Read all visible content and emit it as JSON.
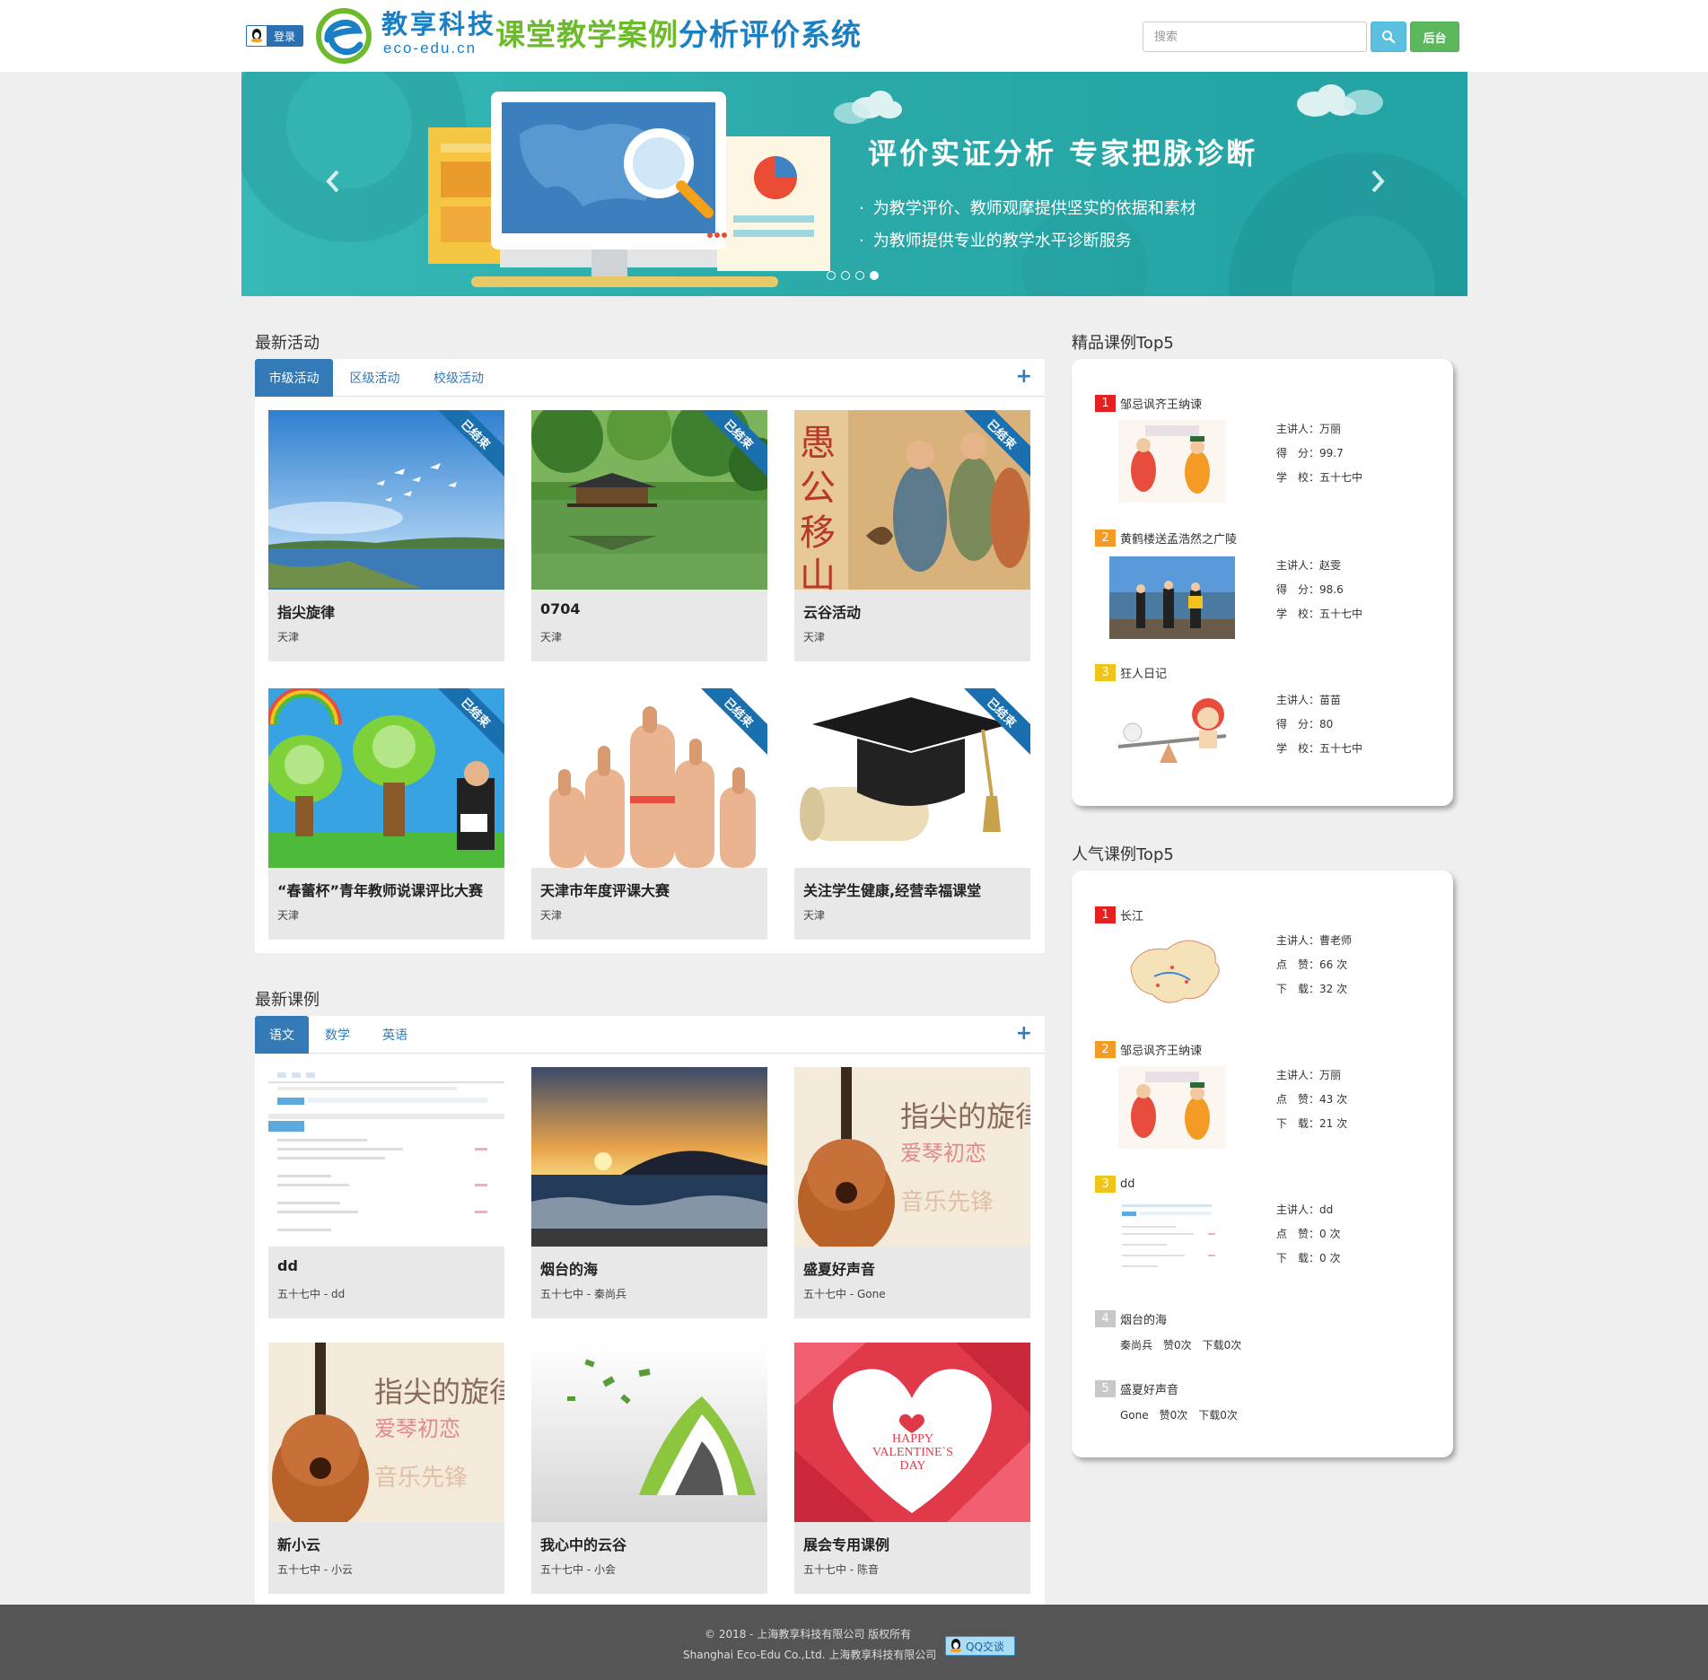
{
  "header": {
    "login_label": "登录",
    "logo_cn": "教享科技",
    "logo_en": "eco-edu.cn",
    "title_green": "课堂教学案例",
    "title_blue": "分析评价系统",
    "search_placeholder": "搜索",
    "admin_label": "后台"
  },
  "banner": {
    "headline": "评价实证分析 专家把脉诊断",
    "bullets": [
      "为教学评价、教师观摩提供坚实的依据和素材",
      "为教师提供专业的教学水平诊断服务"
    ],
    "slide_count": 4,
    "active_slide": 4
  },
  "activities": {
    "title": "最新活动",
    "tabs": [
      "市级活动",
      "区级活动",
      "校级活动"
    ],
    "active_tab": 0,
    "plus": "+",
    "ribbon_label": "已结束",
    "cards": [
      {
        "title": "指尖旋律",
        "sub": "天津",
        "thumb": "sky-lake"
      },
      {
        "title": "0704",
        "sub": "天津",
        "thumb": "pavilion"
      },
      {
        "title": "云谷活动",
        "sub": "天津",
        "thumb": "yugong-painting"
      },
      {
        "title": "“春蕾杯”青年教师说课评比大赛",
        "sub": "天津",
        "thumb": "trees-cartoon"
      },
      {
        "title": "天津市年度评课大赛",
        "sub": "天津",
        "thumb": "thumbs-up"
      },
      {
        "title": "关注学生健康,经营幸福课堂",
        "sub": "天津",
        "thumb": "grad-cap"
      }
    ]
  },
  "lessons": {
    "title": "最新课例",
    "tabs": [
      "语文",
      "数学",
      "英语"
    ],
    "active_tab": 0,
    "plus": "+",
    "cards": [
      {
        "title": "dd",
        "sub": "五十七中 - dd",
        "thumb": "screenshot"
      },
      {
        "title": "烟台的海",
        "sub": "五十七中 - 秦尚兵",
        "thumb": "sunset-sea"
      },
      {
        "title": "盛夏好声音",
        "sub": "五十七中 - Gone",
        "thumb": "guitar"
      },
      {
        "title": "新小云",
        "sub": "五十七中 - 小云",
        "thumb": "guitar"
      },
      {
        "title": "我心中的云谷",
        "sub": "五十七中 - 小会",
        "thumb": "book-art"
      },
      {
        "title": "展会专用课例",
        "sub": "五十七中 - 陈音",
        "thumb": "valentine"
      }
    ],
    "overlay_texts": {
      "guitar_title": "指尖的旋律",
      "guitar_sub1": "爱琴初恋",
      "guitar_sub2": "音乐先锋",
      "valentine": "HAPPY VALENTINE`S DAY"
    }
  },
  "top_quality": {
    "title": "精品课例Top5",
    "items": [
      {
        "rank": "1",
        "name": "邹忌讽齐王纳谏",
        "speaker": "主讲人：万丽",
        "score": "得　分：99.7",
        "school": "学　校：五十七中",
        "color": "#e52020"
      },
      {
        "rank": "2",
        "name": "黄鹤楼送孟浩然之广陵",
        "speaker": "主讲人：赵雯",
        "score": "得　分：98.6",
        "school": "学　校：五十七中",
        "color": "#f39c25"
      },
      {
        "rank": "3",
        "name": "狂人日记",
        "speaker": "主讲人：苗苗",
        "score": "得　分：80",
        "school": "学　校：五十七中",
        "color": "#f0c419"
      }
    ]
  },
  "top_popular": {
    "title": "人气课例Top5",
    "items": [
      {
        "rank": "1",
        "name": "长江",
        "speaker": "主讲人：曹老师",
        "likes": "点　赞：66 次",
        "downloads": "下　载：32 次",
        "color": "#e52020"
      },
      {
        "rank": "2",
        "name": "邹忌讽齐王纳谏",
        "speaker": "主讲人：万丽",
        "likes": "点　赞：43 次",
        "downloads": "下　载：21 次",
        "color": "#f39c25"
      },
      {
        "rank": "3",
        "name": "dd",
        "speaker": "主讲人：dd",
        "likes": "点　赞：0 次",
        "downloads": "下　载：0 次",
        "color": "#f0c419"
      },
      {
        "rank": "4",
        "name": "烟台的海",
        "line": "秦尚兵　赞0次　下载0次",
        "color": "#c8c8c8"
      },
      {
        "rank": "5",
        "name": "盛夏好声音",
        "line": "Gone　赞0次　下载0次",
        "color": "#c8c8c8"
      }
    ]
  },
  "footer": {
    "copyright": "© 2018 - 上海教享科技有限公司 版权所有",
    "company": "Shanghai Eco-Edu Co.,Ltd. 上海教享科技有限公司",
    "qq_label": "QQ交谈"
  },
  "colors": {
    "primary": "#337ab7",
    "banner": "#2aa9a8",
    "search": "#5bc0de",
    "admin": "#5cb85c",
    "footer": "#555555"
  }
}
